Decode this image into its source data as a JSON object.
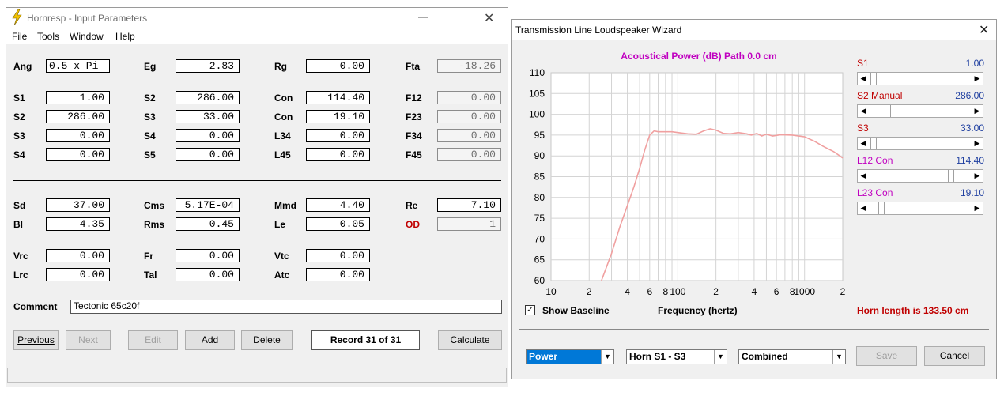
{
  "left_window": {
    "title": "Hornresp - Input Parameters",
    "menu": [
      "File",
      "Tools",
      "Window",
      "Help"
    ],
    "row1": [
      {
        "label": "Ang",
        "value": "0.5 x Pi"
      },
      {
        "label": "Eg",
        "value": "2.83"
      },
      {
        "label": "Rg",
        "value": "0.00"
      },
      {
        "label": "Fta",
        "value": "-18.26"
      }
    ],
    "grid_a": [
      [
        {
          "label": "S1",
          "value": "1.00"
        },
        {
          "label": "S2",
          "value": "286.00"
        },
        {
          "label": "Con",
          "value": "114.40"
        },
        {
          "label": "F12",
          "value": "0.00"
        }
      ],
      [
        {
          "label": "S2",
          "value": "286.00"
        },
        {
          "label": "S3",
          "value": "33.00"
        },
        {
          "label": "Con",
          "value": "19.10"
        },
        {
          "label": "F23",
          "value": "0.00"
        }
      ],
      [
        {
          "label": "S3",
          "value": "0.00"
        },
        {
          "label": "S4",
          "value": "0.00"
        },
        {
          "label": "L34",
          "value": "0.00"
        },
        {
          "label": "F34",
          "value": "0.00"
        }
      ],
      [
        {
          "label": "S4",
          "value": "0.00"
        },
        {
          "label": "S5",
          "value": "0.00"
        },
        {
          "label": "L45",
          "value": "0.00"
        },
        {
          "label": "F45",
          "value": "0.00"
        }
      ]
    ],
    "grid_b": [
      [
        {
          "label": "Sd",
          "value": "37.00"
        },
        {
          "label": "Cms",
          "value": "5.17E-04"
        },
        {
          "label": "Mmd",
          "value": "4.40"
        },
        {
          "label": "Re",
          "value": "7.10"
        }
      ],
      [
        {
          "label": "Bl",
          "value": "4.35"
        },
        {
          "label": "Rms",
          "value": "0.45"
        },
        {
          "label": "Le",
          "value": "0.05"
        },
        {
          "label": "OD",
          "value": "1"
        }
      ]
    ],
    "grid_c": [
      [
        {
          "label": "Vrc",
          "value": "0.00"
        },
        {
          "label": "Fr",
          "value": "0.00"
        },
        {
          "label": "Vtc",
          "value": "0.00"
        }
      ],
      [
        {
          "label": "Lrc",
          "value": "0.00"
        },
        {
          "label": "Tal",
          "value": "0.00"
        },
        {
          "label": "Atc",
          "value": "0.00"
        }
      ]
    ],
    "comment_label": "Comment",
    "comment_value": "Tectonic 65c20f",
    "buttons": {
      "previous": "Previous",
      "next": "Next",
      "edit": "Edit",
      "add": "Add",
      "delete": "Delete",
      "calculate": "Calculate"
    },
    "record": "Record 31 of 31",
    "colors": {
      "od_label": "#c00000"
    }
  },
  "right_window": {
    "title": "Transmission Line Loudspeaker Wizard",
    "sliders": [
      {
        "name": "S1",
        "name_color": "#c00000",
        "value": "1.00",
        "position": 0.02
      },
      {
        "name": "S2  Manual",
        "name_color": "#c00000",
        "value": "286.00",
        "position": 0.22
      },
      {
        "name": "S3",
        "name_color": "#c00000",
        "value": "33.00",
        "position": 0.02
      },
      {
        "name": "L12  Con",
        "name_color": "#c000c0",
        "value": "114.40",
        "position": 0.82
      },
      {
        "name": "L23  Con",
        "name_color": "#c000c0",
        "value": "19.10",
        "position": 0.1
      }
    ],
    "show_baseline": "Show Baseline",
    "frequency_label": "Frequency (hertz)",
    "horn_length": "Horn length is 133.50 cm",
    "combos": [
      "Power",
      "Horn S1 - S3",
      "Combined"
    ],
    "buttons": {
      "save": "Save",
      "cancel": "Cancel"
    },
    "colors": {
      "title": "#c000c0",
      "curve": "#f0a0a0",
      "horn_length": "#c00000"
    }
  },
  "chart_data": {
    "type": "line",
    "title": "Acoustical Power (dB)   Path 0.0 cm",
    "xscale": "log",
    "xlim": [
      10,
      2000
    ],
    "ylim": [
      60,
      110
    ],
    "y_ticks": [
      "110",
      "105",
      "100",
      "95",
      "90",
      "85",
      "80",
      "75",
      "70",
      "65",
      "60"
    ],
    "x_ticks": [
      {
        "v": 10,
        "t": "10"
      },
      {
        "v": 20,
        "t": "2"
      },
      {
        "v": 40,
        "t": "4"
      },
      {
        "v": 60,
        "t": "6"
      },
      {
        "v": 80,
        "t": "8"
      },
      {
        "v": 100,
        "t": "100"
      },
      {
        "v": 200,
        "t": "2"
      },
      {
        "v": 400,
        "t": "4"
      },
      {
        "v": 600,
        "t": "6"
      },
      {
        "v": 800,
        "t": "8"
      },
      {
        "v": 1000,
        "t": "1000"
      },
      {
        "v": 2000,
        "t": "2"
      }
    ],
    "grid": true,
    "series": [
      {
        "x": [
          25,
          30,
          35,
          40,
          45,
          50,
          55,
          60,
          65,
          70,
          80,
          90,
          100,
          120,
          140,
          160,
          180,
          200,
          230,
          260,
          300,
          350,
          380,
          420,
          460,
          500,
          560,
          650,
          800,
          1000,
          1200,
          1400,
          1700,
          2000
        ],
        "y": [
          60,
          66.5,
          73,
          78,
          82.5,
          87,
          91.5,
          95,
          96,
          95.8,
          95.8,
          95.8,
          95.6,
          95.3,
          95.2,
          96,
          96.5,
          96.2,
          95.4,
          95.3,
          95.6,
          95.3,
          95,
          95.4,
          94.8,
          95.2,
          94.8,
          95.1,
          95,
          94.6,
          93.5,
          92.3,
          91,
          89.5
        ]
      }
    ]
  }
}
